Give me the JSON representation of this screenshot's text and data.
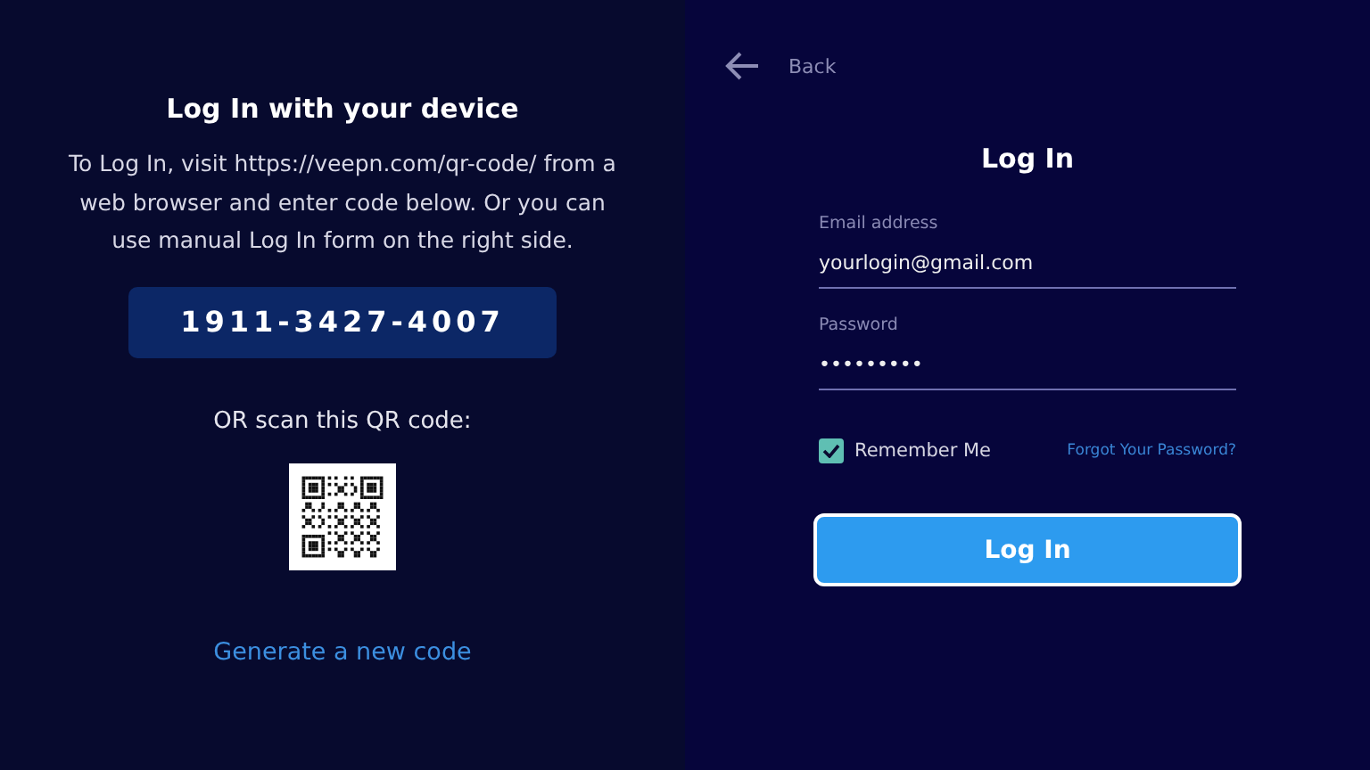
{
  "device_login": {
    "title": "Log In with your device",
    "instructions": "To Log In, visit https://veepn.com/qr-code/ from a web browser and enter code below. Or you can use manual Log In form on the right side.",
    "code": "1911-3427-4007",
    "qr_caption": "OR scan this QR code:",
    "generate_link": "Generate a new code"
  },
  "form": {
    "back": "Back",
    "title": "Log In",
    "fields": [
      {
        "label": "Email address",
        "value": "yourlogin@gmail.com"
      },
      {
        "label": "Password",
        "value": "•••••••••"
      }
    ],
    "remember": {
      "label": "Remember Me",
      "checked": true
    },
    "forgot_link": "Forgot Your Password?",
    "submit": "Log In"
  }
}
